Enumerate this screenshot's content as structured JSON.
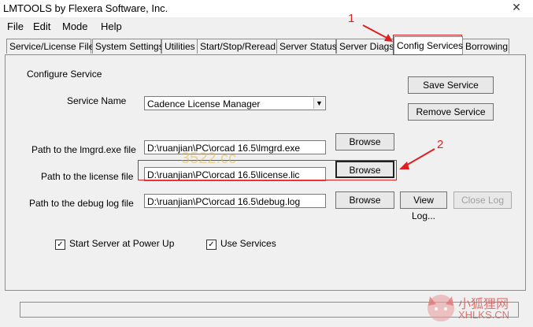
{
  "window": {
    "title": "LMTOOLS by Flexera Software, Inc.",
    "close_glyph": "✕"
  },
  "menu": [
    "File",
    "Edit",
    "Mode",
    "Help"
  ],
  "tabs": [
    "Service/License File",
    "System Settings",
    "Utilities",
    "Start/Stop/Reread",
    "Server Status",
    "Server Diags",
    "Config Services",
    "Borrowing"
  ],
  "active_tab": "Config Services",
  "config": {
    "section_title": "Configure Service",
    "service_name_label": "Service Name",
    "service_name_value": "Cadence License Manager",
    "lmgrd_label": "Path to the lmgrd.exe file",
    "lmgrd_value": "D:\\ruanjian\\PC\\orcad 16.5\\lmgrd.exe",
    "license_label": "Path to the license file",
    "license_value": "D:\\ruanjian\\PC\\orcad 16.5\\license.lic",
    "debug_label": "Path to the debug log file",
    "debug_value": "D:\\ruanjian\\PC\\orcad 16.5\\debug.log",
    "save_service": "Save Service",
    "remove_service": "Remove Service",
    "browse": "Browse",
    "view_log": "View Log...",
    "close_log": "Close Log",
    "start_server_label": "Start Server at Power Up",
    "use_services_label": "Use Services",
    "start_server_checked": true,
    "use_services_checked": true
  },
  "annotations": {
    "num1": "1",
    "num2": "2",
    "red_color": "#e02020"
  },
  "watermark": {
    "text1": "3522.cc",
    "text2": "小狐狸网",
    "text3": "XHLKS.CN"
  }
}
